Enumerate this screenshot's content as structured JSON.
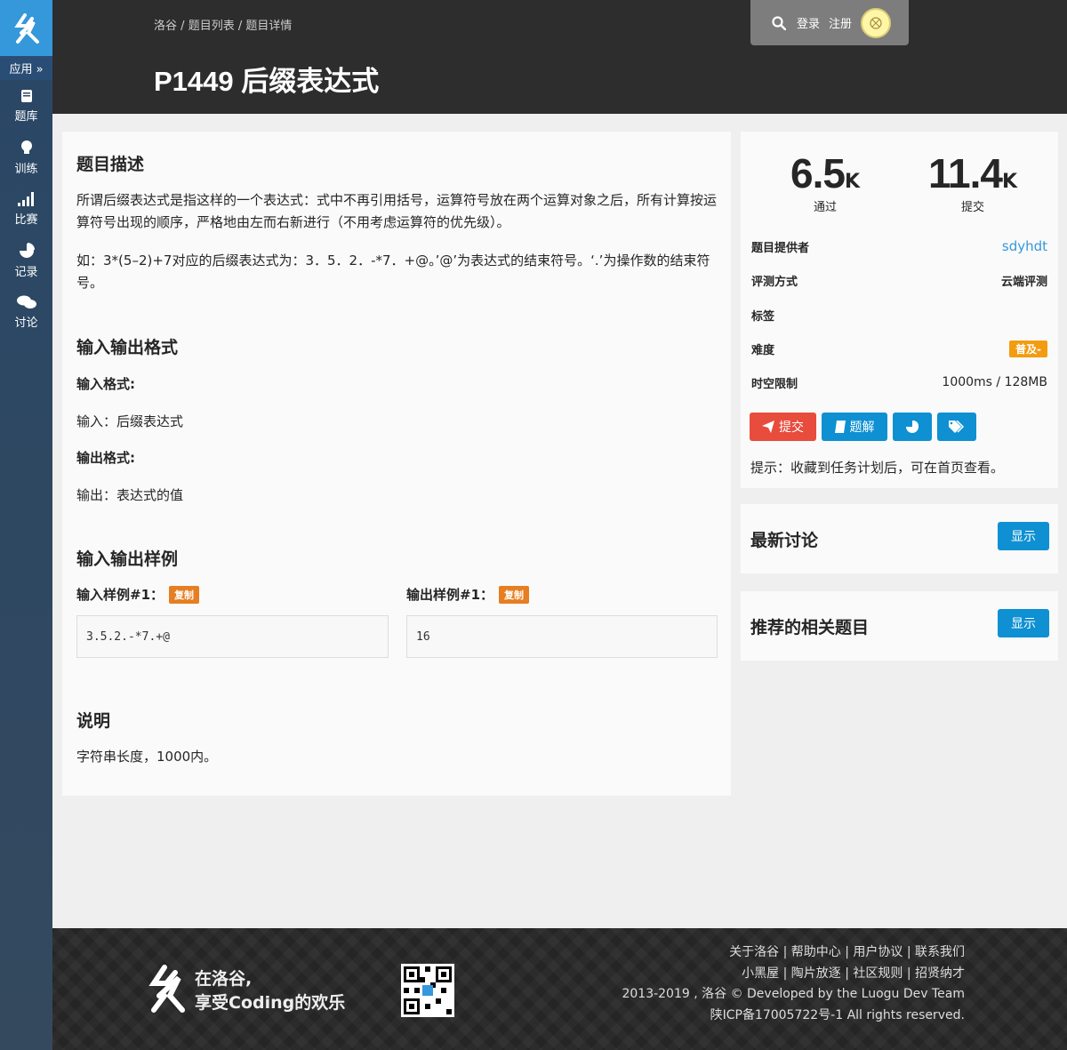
{
  "sidebar": {
    "apps_label": "应用 »",
    "items": [
      {
        "label": "题库",
        "icon": "book-icon"
      },
      {
        "label": "训练",
        "icon": "lightbulb-icon"
      },
      {
        "label": "比赛",
        "icon": "signal-bars-icon"
      },
      {
        "label": "记录",
        "icon": "pie-chart-icon"
      },
      {
        "label": "讨论",
        "icon": "comments-icon"
      }
    ]
  },
  "header": {
    "breadcrumb": {
      "home": "洛谷",
      "sep": "/",
      "list": "题目列表",
      "detail": "题目详情"
    },
    "title": "P1449 后缀表达式",
    "login": "登录",
    "register": "注册"
  },
  "problem": {
    "desc_title": "题目描述",
    "desc_p1": "所谓后缀表达式是指这样的一个表达式：式中不再引用括号，运算符号放在两个运算对象之后，所有计算按运算符号出现的顺序，严格地由左而右新进行（不用考虑运算符的优先级）。",
    "desc_p2": "如：3*(5–2)+7对应的后缀表达式为：3．5．2．-*7．+@。’@’为表达式的结束符号。‘.’为操作数的结束符号。",
    "io_title": "输入输出格式",
    "input_fmt_label": "输入格式:",
    "input_fmt": "输入：后缀表达式",
    "output_fmt_label": "输出格式:",
    "output_fmt": "输出：表达式的值",
    "sample_title": "输入输出样例",
    "sample_in_label": "输入样例#1：",
    "sample_out_label": "输出样例#1：",
    "copy_label": "复制",
    "sample_in": "3.5.2.-*7.+@",
    "sample_out": "16",
    "note_title": "说明",
    "note": "字符串长度，1000内。"
  },
  "stats": {
    "passed": "6.5",
    "passed_unit": "K",
    "passed_label": "通过",
    "submitted": "11.4",
    "submitted_unit": "K",
    "submitted_label": "提交"
  },
  "info": {
    "provider_label": "题目提供者",
    "provider": "sdyhdt",
    "judge_label": "评测方式",
    "judge": "云端评测",
    "tags_label": "标签",
    "difficulty_label": "难度",
    "difficulty": "普及-",
    "limit_label": "时空限制",
    "limit": "1000ms / 128MB"
  },
  "actions": {
    "submit": "提交",
    "solution": "题解",
    "tip": "提示：收藏到任务计划后，可在首页查看。"
  },
  "discussion": {
    "title": "最新讨论",
    "show": "显示"
  },
  "related": {
    "title": "推荐的相关题目",
    "show": "显示"
  },
  "footer": {
    "slogan1": "在洛谷,",
    "slogan2": "享受Coding的欢乐",
    "links1": "关于洛谷 | 帮助中心 | 用户协议 | 联系我们",
    "links2": "小黑屋 | 陶片放逐 | 社区规则 | 招贤纳才",
    "copyright": "2013-2019 , 洛谷 © Developed by the Luogu Dev Team",
    "icp": "陕ICP备17005722号-1 All rights reserved."
  },
  "colors": {
    "brand": "#3498db",
    "submit": "#e74c3c",
    "primary": "#0e90d2",
    "difficulty": "#f39c11",
    "copy": "#e67e22"
  }
}
